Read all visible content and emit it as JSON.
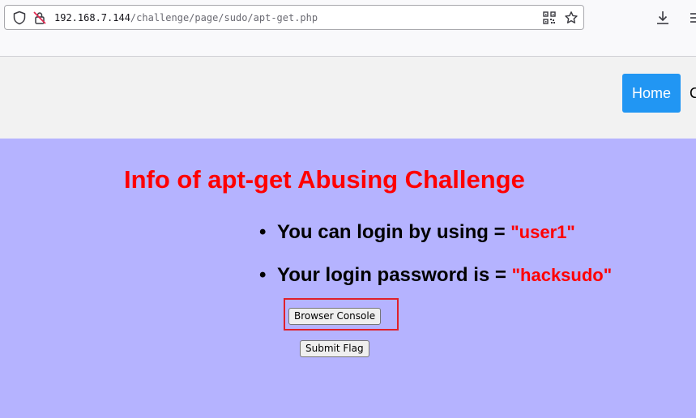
{
  "browser": {
    "url_host": "192.168.7.144",
    "url_path": "/challenge/page/sudo/apt-get.php",
    "icons": [
      "shield-icon",
      "lock-warning-icon",
      "qr-code-icon",
      "bookmark-star-icon",
      "download-icon"
    ]
  },
  "nav": {
    "home_label": "Home",
    "next_label_partial": "C"
  },
  "main": {
    "title": "Info of apt-get Abusing Challenge",
    "info": [
      {
        "label": "You can login by using = ",
        "value": "\"user1\""
      },
      {
        "label": "Your login password is = ",
        "value": "\"hacksudo\""
      }
    ],
    "console_button": "Browser Console",
    "flag_button": "Submit Flag"
  },
  "colors": {
    "background": "#b5b3ff",
    "title": "#ff0000",
    "nav_button": "#2196f3",
    "highlight_box": "#e0202a"
  }
}
